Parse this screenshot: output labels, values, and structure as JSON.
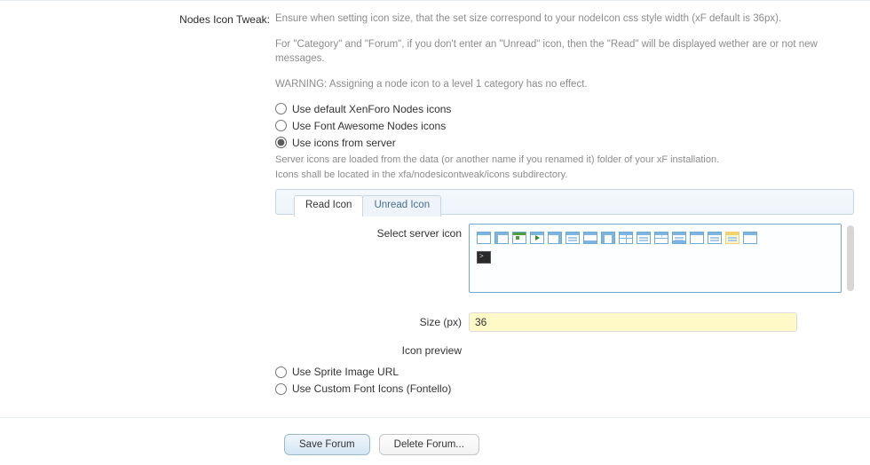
{
  "section": {
    "label": "Nodes Icon Tweak:",
    "desc1": "Ensure when setting icon size, that the set size correspond to your nodeIcon css style width (xF default is 36px).",
    "desc2": "For \"Category\" and \"Forum\", if you don't enter an \"Unread\" icon, then the \"Read\" will be displayed wether are or not new messages.",
    "desc3": "WARNING: Assigning a node icon to a level 1 category has no effect."
  },
  "options": {
    "default": "Use default XenForo Nodes icons",
    "fa": "Use Font Awesome Nodes icons",
    "server": "Use icons from server",
    "server_desc1": "Server icons are loaded from the data (or another name if you renamed it) folder of your xF installation.",
    "server_desc2": "Icons shall be located in the xfa/nodesicontweak/icons subdirectory.",
    "sprite": "Use Sprite Image URL",
    "fontello": "Use Custom Font Icons (Fontello)",
    "selected": "server"
  },
  "tabs": {
    "read": "Read Icon",
    "unread": "Unread Icon",
    "active": "read"
  },
  "picker": {
    "label": "Select server icon",
    "icons": [
      {
        "name": "layout-top"
      },
      {
        "name": "layout-top-left"
      },
      {
        "name": "layout-flag-green"
      },
      {
        "name": "layout-play"
      },
      {
        "name": "layout-top-right"
      },
      {
        "name": "layout-top-stripes"
      },
      {
        "name": "layout-bottom"
      },
      {
        "name": "layout-left-right"
      },
      {
        "name": "layout-grid"
      },
      {
        "name": "layout-stripes-a"
      },
      {
        "name": "layout-grid-b"
      },
      {
        "name": "layout-stripes-b"
      },
      {
        "name": "layout-plain"
      },
      {
        "name": "layout-plain-b"
      },
      {
        "name": "layout-sel"
      },
      {
        "name": "layout-empty"
      },
      {
        "name": "terminal"
      }
    ]
  },
  "size": {
    "label": "Size (px)",
    "value": "36"
  },
  "preview": {
    "label": "Icon preview"
  },
  "footer": {
    "save": "Save Forum",
    "delete": "Delete Forum..."
  }
}
